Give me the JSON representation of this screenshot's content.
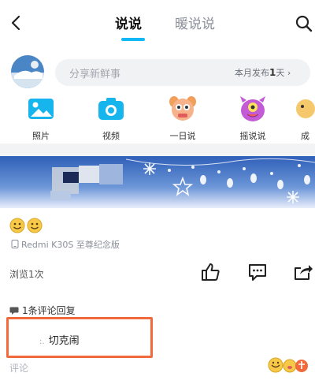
{
  "header": {
    "tabs": [
      "说说",
      "暖说说"
    ]
  },
  "compose": {
    "placeholder": "分享新鲜事",
    "stats_prefix": "本月发布",
    "stats_days": "1",
    "stats_suffix": "天",
    "arrow": "›"
  },
  "actions": [
    {
      "label": "照片",
      "icon": "photo-icon"
    },
    {
      "label": "视频",
      "icon": "camera-icon"
    },
    {
      "label": "一日说",
      "icon": "mascot-icon"
    },
    {
      "label": "摇说说",
      "icon": "monster-icon"
    },
    {
      "label": "成",
      "icon": "partial-icon"
    }
  ],
  "post": {
    "device": "Redmi K30S 至尊纪念版",
    "views": "浏览1次",
    "comment_header": "1条评论回复",
    "comment_prefix": ":.",
    "comment_text": "切克闹",
    "comment_input_placeholder": "评论"
  },
  "colors": {
    "accent": "#12b7f5",
    "highlight_box": "#f06a3c"
  }
}
